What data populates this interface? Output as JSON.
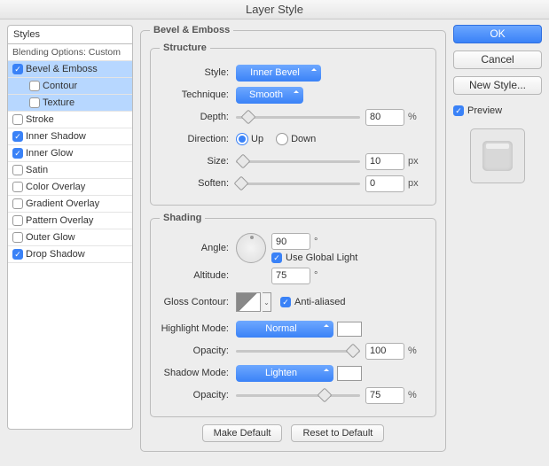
{
  "window": {
    "title": "Layer Style"
  },
  "left": {
    "header": "Styles",
    "blending": "Blending Options: Custom",
    "items": [
      {
        "label": "Bevel & Emboss",
        "checked": true,
        "selected": true
      },
      {
        "label": "Contour",
        "checked": false,
        "sub": true,
        "selected": true
      },
      {
        "label": "Texture",
        "checked": false,
        "sub": true,
        "selected": true
      },
      {
        "label": "Stroke",
        "checked": false
      },
      {
        "label": "Inner Shadow",
        "checked": true
      },
      {
        "label": "Inner Glow",
        "checked": true
      },
      {
        "label": "Satin",
        "checked": false
      },
      {
        "label": "Color Overlay",
        "checked": false
      },
      {
        "label": "Gradient Overlay",
        "checked": false
      },
      {
        "label": "Pattern Overlay",
        "checked": false
      },
      {
        "label": "Outer Glow",
        "checked": false
      },
      {
        "label": "Drop Shadow",
        "checked": true
      }
    ]
  },
  "panel": {
    "title": "Bevel & Emboss",
    "structure": {
      "title": "Structure",
      "style_label": "Style:",
      "style_value": "Inner Bevel",
      "technique_label": "Technique:",
      "technique_value": "Smooth",
      "depth_label": "Depth:",
      "depth_value": "80",
      "depth_unit": "%",
      "direction_label": "Direction:",
      "up": "Up",
      "down": "Down",
      "size_label": "Size:",
      "size_value": "10",
      "size_unit": "px",
      "soften_label": "Soften:",
      "soften_value": "0",
      "soften_unit": "px"
    },
    "shading": {
      "title": "Shading",
      "angle_label": "Angle:",
      "angle_value": "90",
      "angle_unit": "°",
      "global_label": "Use Global Light",
      "altitude_label": "Altitude:",
      "altitude_value": "75",
      "altitude_unit": "°",
      "gloss_label": "Gloss Contour:",
      "aa_label": "Anti-aliased",
      "highlight_label": "Highlight Mode:",
      "highlight_value": "Normal",
      "h_opacity_label": "Opacity:",
      "h_opacity_value": "100",
      "h_opacity_unit": "%",
      "shadow_label": "Shadow Mode:",
      "shadow_value": "Lighten",
      "s_opacity_label": "Opacity:",
      "s_opacity_value": "75",
      "s_opacity_unit": "%"
    },
    "make_default": "Make Default",
    "reset_default": "Reset to Default"
  },
  "right": {
    "ok": "OK",
    "cancel": "Cancel",
    "new_style": "New Style...",
    "preview": "Preview"
  }
}
